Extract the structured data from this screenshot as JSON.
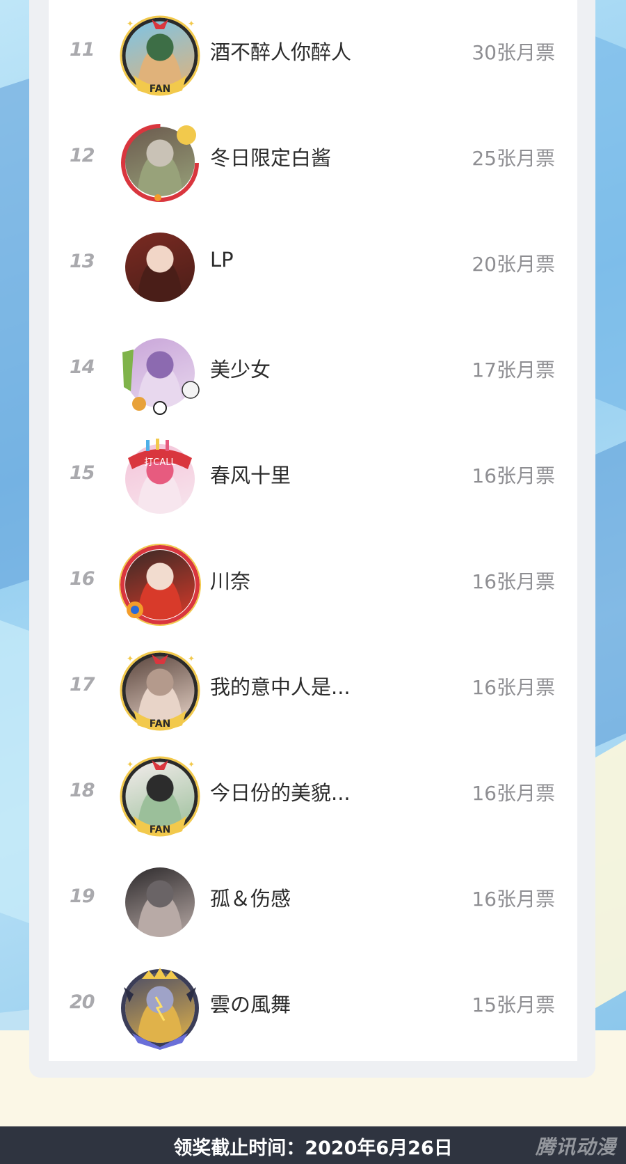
{
  "leaderboard": {
    "rows": [
      {
        "rank": "11",
        "name": "酒不醉人你醉人",
        "votes": "30张月票",
        "avatar_icon": "fan-badge-avatar-icon",
        "avatar_colors": [
          "#7cc4e6",
          "#3d6e46",
          "#e0b27a"
        ]
      },
      {
        "rank": "12",
        "name": "冬日限定白酱",
        "votes": "25张月票",
        "avatar_icon": "red-ring-avatar-icon",
        "avatar_colors": [
          "#6b5a4e",
          "#c9c2b6",
          "#98a27a"
        ]
      },
      {
        "rank": "13",
        "name": "LP",
        "votes": "20张月票",
        "avatar_icon": "anime-girl-avatar-icon",
        "avatar_colors": [
          "#7a2a22",
          "#f1d6c7",
          "#4a1e18"
        ]
      },
      {
        "rank": "14",
        "name": "美少女",
        "votes": "17张月票",
        "avatar_icon": "bamboo-panda-avatar-icon",
        "avatar_colors": [
          "#c9a6d9",
          "#8c6ab0",
          "#e8d8ee"
        ]
      },
      {
        "rank": "15",
        "name": "春风十里",
        "votes": "16张月票",
        "avatar_icon": "call-avatar-icon",
        "avatar_colors": [
          "#f4c3d8",
          "#e75b7f",
          "#f7e6ee"
        ]
      },
      {
        "rank": "16",
        "name": "川奈",
        "votes": "16张月票",
        "avatar_icon": "red-festival-avatar-icon",
        "avatar_colors": [
          "#3a2a26",
          "#f2dccf",
          "#d83a2a"
        ]
      },
      {
        "rank": "17",
        "name": "我的意中人是...",
        "votes": "16张月票",
        "avatar_icon": "fan-badge-avatar-icon",
        "avatar_colors": [
          "#5b463e",
          "#b49a8c",
          "#e8d4c8"
        ]
      },
      {
        "rank": "18",
        "name": "今日份的美貌...",
        "votes": "16张月票",
        "avatar_icon": "fan-badge-avatar-icon",
        "avatar_colors": [
          "#f3ecec",
          "#2c2c2c",
          "#9bbf9a"
        ]
      },
      {
        "rank": "19",
        "name": "孤＆伤感",
        "votes": "16张月票",
        "avatar_icon": "dark-hair-avatar-icon",
        "avatar_colors": [
          "#2d2a2c",
          "#6a6466",
          "#b8aaa6"
        ]
      },
      {
        "rank": "20",
        "name": "雲の風舞",
        "votes": "15张月票",
        "avatar_icon": "crown-avatar-icon",
        "avatar_colors": [
          "#4a4c66",
          "#9fa3c8",
          "#e0b24a"
        ]
      }
    ]
  },
  "footer": {
    "deadline": "领奖截止时间：2020年6月26日",
    "watermark": "腾讯动漫"
  },
  "colors": {
    "badge_gold": "#f2c94c",
    "badge_red": "#d9363e",
    "text_primary": "#2b2b2b",
    "text_secondary": "#8e8e92"
  }
}
